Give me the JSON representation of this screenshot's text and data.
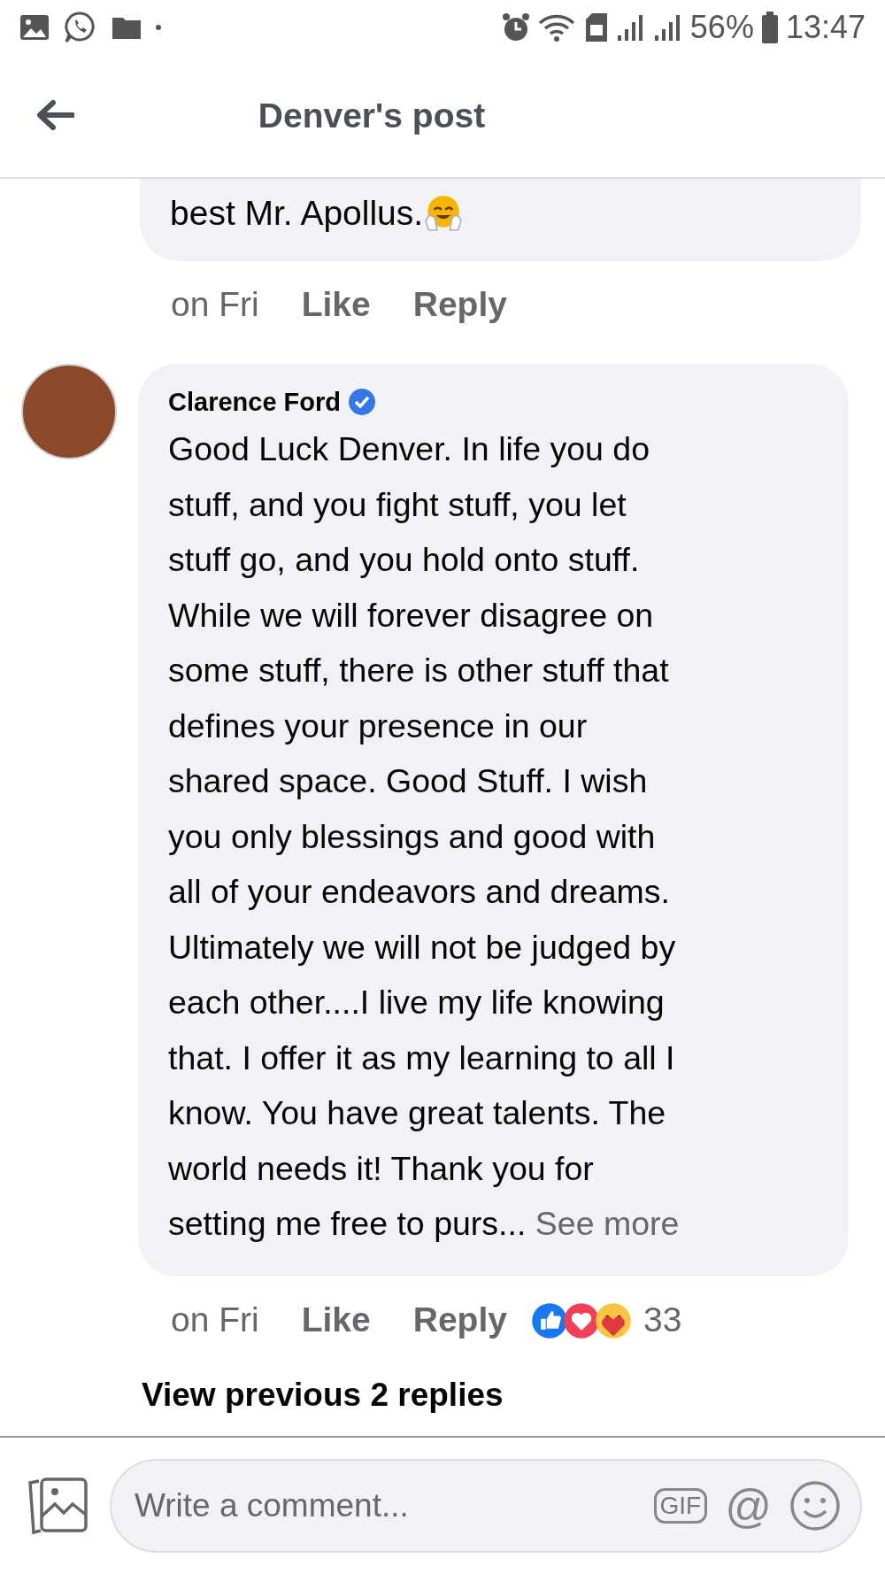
{
  "status_bar": {
    "battery": "56%",
    "time": "13:47"
  },
  "header": {
    "title": "Denver's post"
  },
  "comments": [
    {
      "text": "best Mr. Apollus.",
      "timestamp": "on Fri",
      "actions": [
        "Like",
        "Reply"
      ]
    },
    {
      "author": "Clarence Ford",
      "verified": true,
      "text": "Good Luck Denver. In life you do\nstuff, and you fight stuff, you let\nstuff go, and you hold onto stuff.\nWhile we will forever disagree on\nsome stuff, there is other stuff that\ndefines your presence in our\nshared space. Good Stuff. I wish\nyou only blessings and good with\nall of your endeavors and dreams.\nUltimately we will not be judged by\neach other....I live my life knowing\nthat. I offer it as my learning to all I\nknow. You have great talents. The\nworld needs it! Thank you for\nsetting me free to purs...",
      "see_more": "See more",
      "timestamp": "on Fri",
      "actions": [
        "Like",
        "Reply"
      ],
      "reaction_count": "33"
    }
  ],
  "view_replies": "View previous 2 replies",
  "composer": {
    "placeholder": "Write a comment...",
    "gif": "GIF",
    "mention": "@"
  }
}
